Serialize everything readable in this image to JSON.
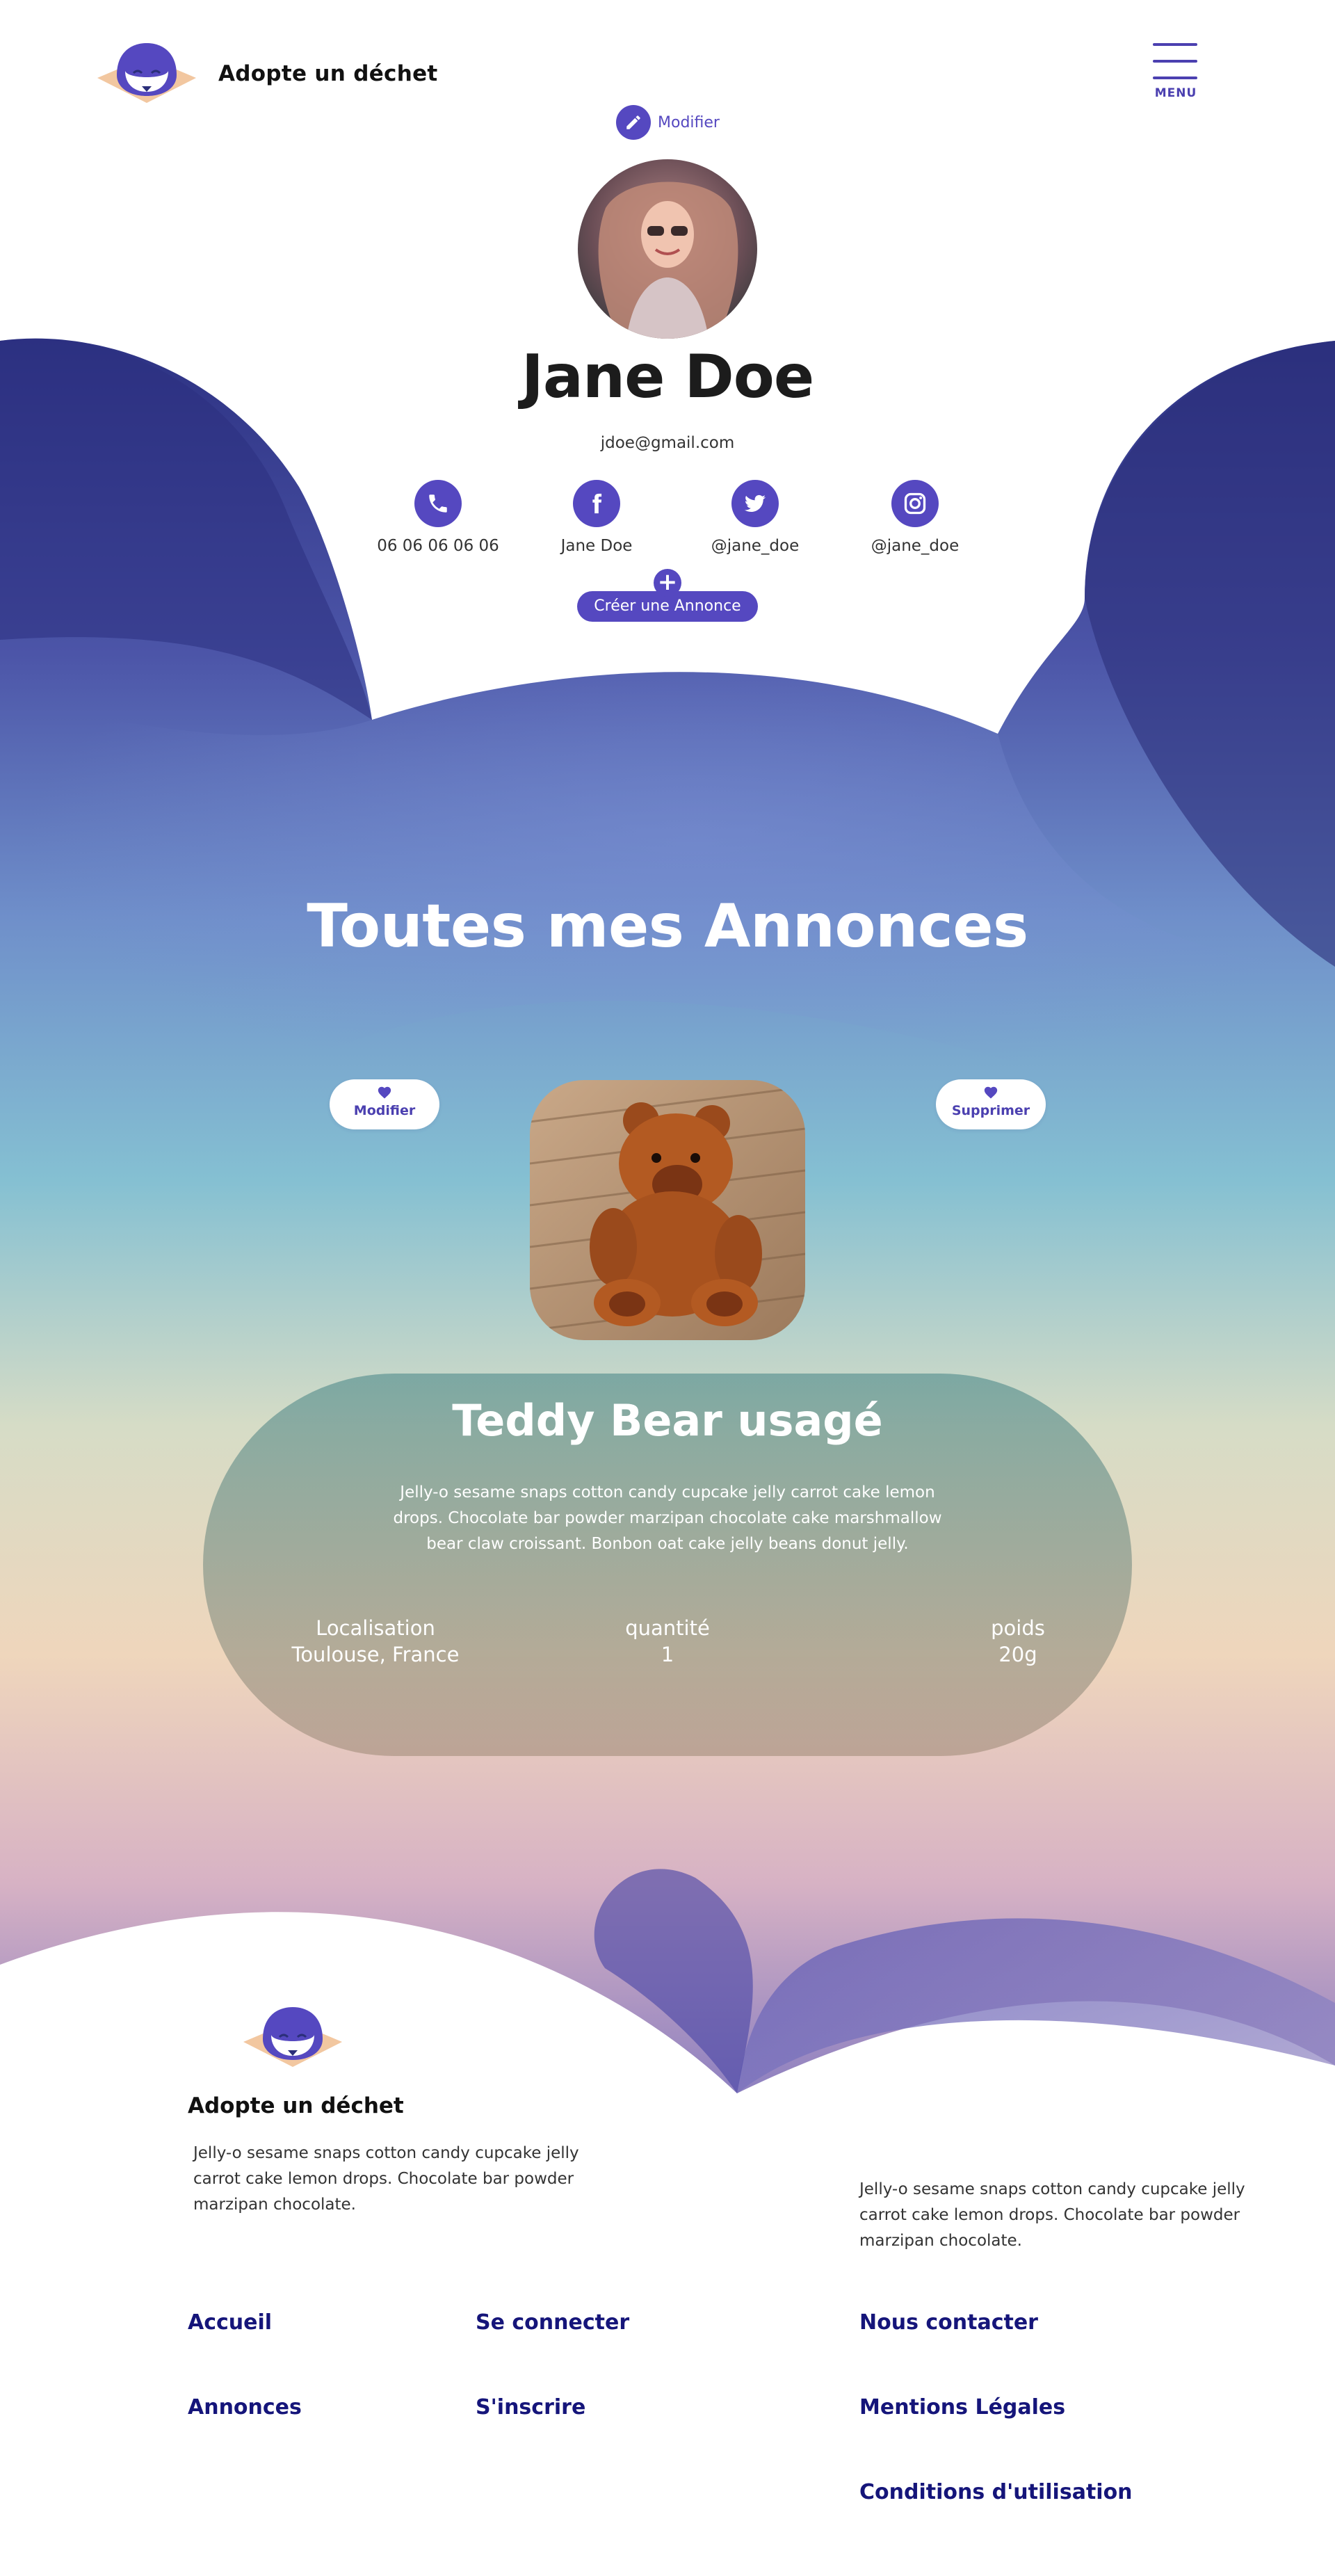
{
  "brand": {
    "name": "Adopte un déchet"
  },
  "menu": {
    "label": "MENU"
  },
  "profile": {
    "edit_label": "Modifier",
    "name": "Jane Doe",
    "email": "jdoe@gmail.com",
    "contacts": [
      {
        "icon": "phone-icon",
        "label": "06 06 06 06 06"
      },
      {
        "icon": "facebook-icon",
        "label": "Jane Doe"
      },
      {
        "icon": "twitter-icon",
        "label": "@jane_doe"
      },
      {
        "icon": "instagram-icon",
        "label": "@jane_doe"
      }
    ],
    "create_button": "Créer une Annonce"
  },
  "listings": {
    "section_title": "Toutes mes Annonces",
    "edit_label": "Modifier",
    "delete_label": "Supprimer",
    "item": {
      "title": "Teddy Bear usagé",
      "description": "Jelly-o sesame snaps cotton candy cupcake jelly carrot cake lemon drops. Chocolate bar powder marzipan chocolate cake marshmallow bear claw croissant. Bonbon oat cake jelly beans donut jelly.",
      "location_label": "Localisation",
      "location_value": "Toulouse, France",
      "quantity_label": "quantité",
      "quantity_value": "1",
      "weight_label": "poids",
      "weight_value": "20g"
    }
  },
  "footer": {
    "brand": "Adopte un déchet",
    "text_left": "Jelly-o sesame snaps cotton candy cupcake jelly carrot cake lemon drops. Chocolate bar powder marzipan chocolate.",
    "text_right": "Jelly-o sesame snaps cotton candy cupcake jelly carrot cake lemon drops. Chocolate bar powder marzipan chocolate.",
    "links": {
      "home": "Accueil",
      "listings": "Annonces",
      "login": "Se connecter",
      "signup": "S'inscrire",
      "contact": "Nous contacter",
      "legal": "Mentions Légales",
      "terms": "Conditions d'utilisation"
    }
  },
  "colors": {
    "accent": "#5548c0",
    "indigo_dark": "#2b2f7a",
    "link": "#15157a"
  }
}
